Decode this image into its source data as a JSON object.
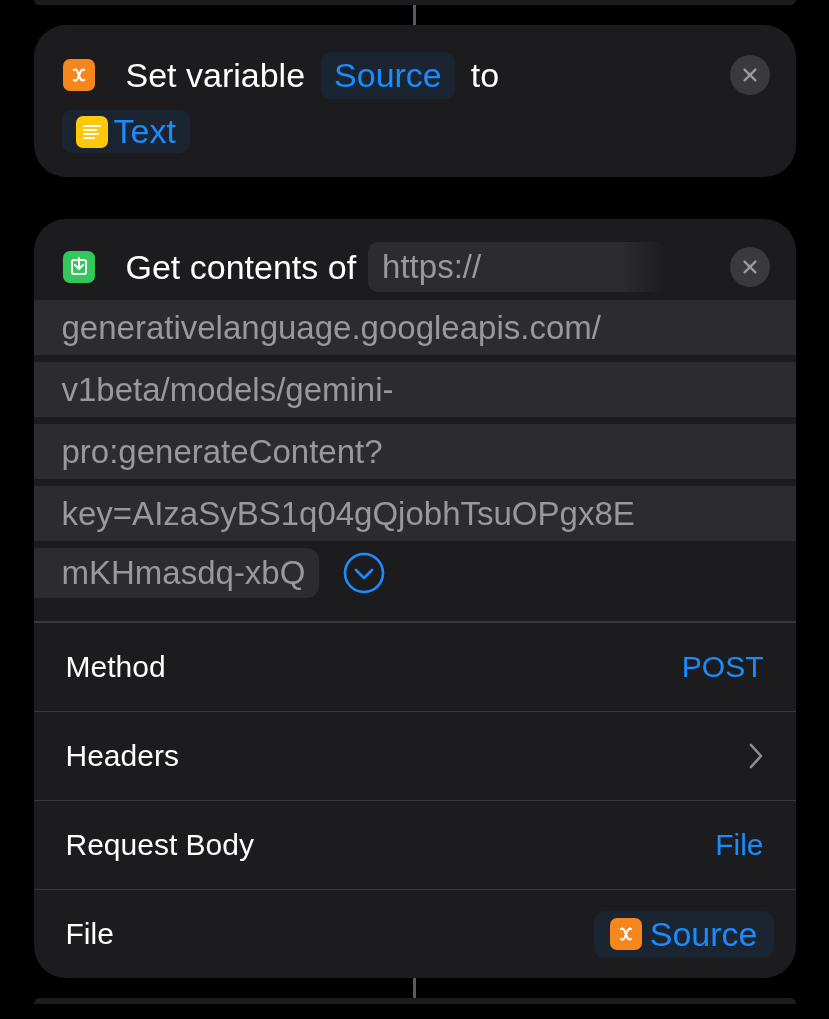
{
  "actions": [
    {
      "kind": "set_variable",
      "label": "Set variable",
      "variable": "Source",
      "connector": "to",
      "value": "Text"
    },
    {
      "kind": "get_contents",
      "label": "Get contents of",
      "url_lines": [
        "https://",
        "generativelanguage.googleapis.com/",
        "v1beta/models/gemini-",
        "pro:generateContent?",
        "key=AIzaSyBS1q04gQjobhTsuOPgx8E",
        "mKHmasdq-xbQ"
      ],
      "expanded": true,
      "rows": [
        {
          "kind": "value",
          "label": "Method",
          "value": "POST"
        },
        {
          "kind": "disclosure",
          "label": "Headers"
        },
        {
          "kind": "value",
          "label": "Request Body",
          "value": "File"
        },
        {
          "kind": "variable",
          "label": "File",
          "value": "Source"
        }
      ]
    }
  ]
}
